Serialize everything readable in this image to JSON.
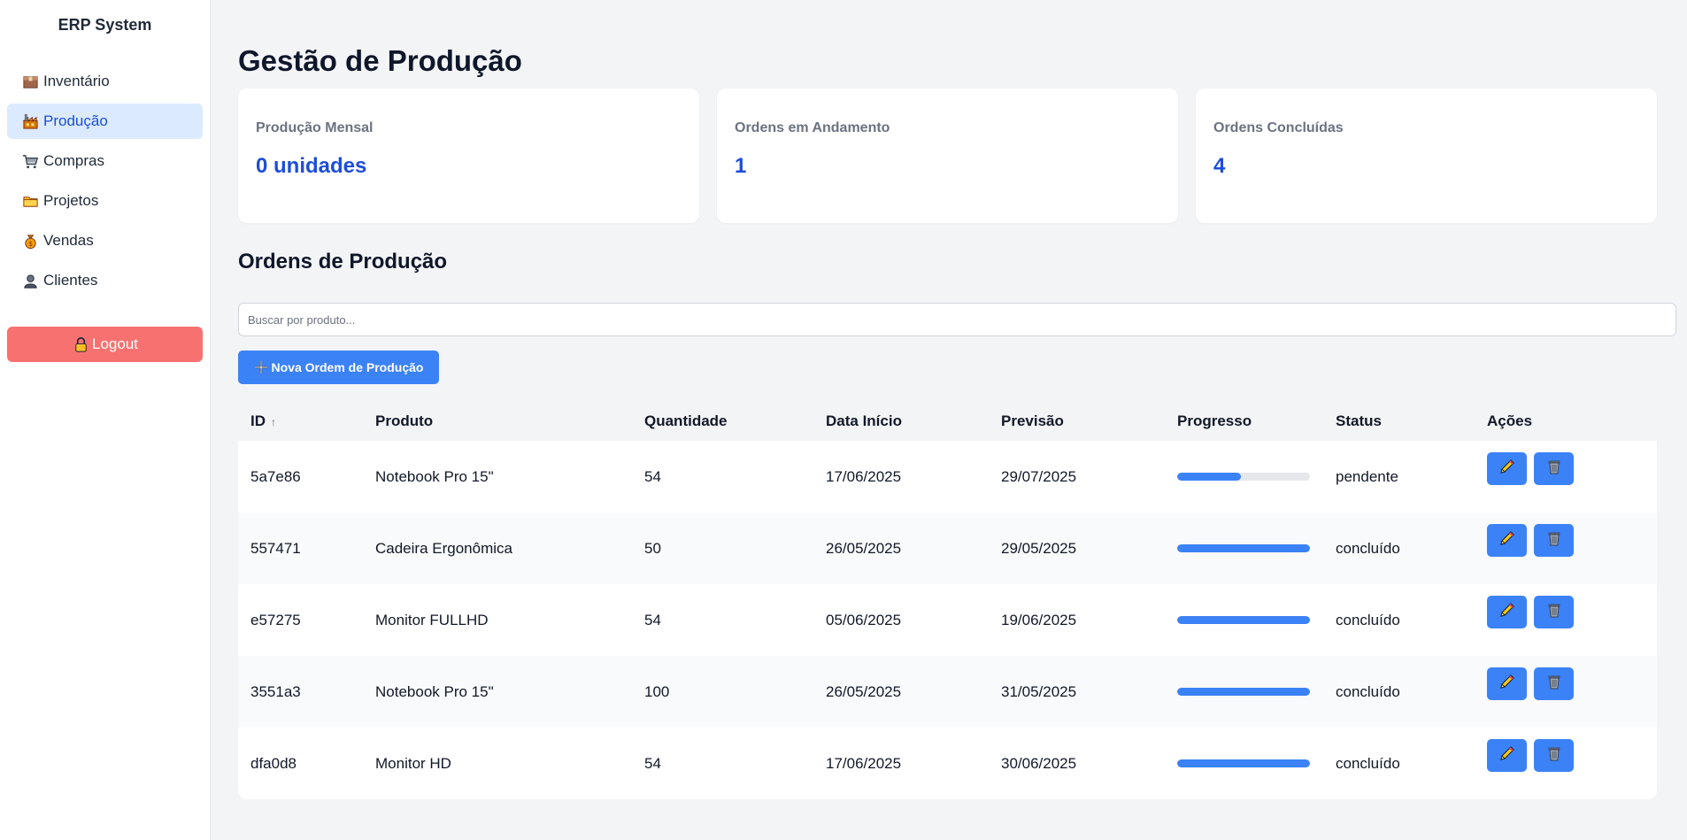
{
  "app": {
    "title": "ERP System"
  },
  "sidebar": {
    "items": [
      {
        "label": "Inventário",
        "icon": "package-icon",
        "active": false
      },
      {
        "label": "Produção",
        "icon": "factory-icon",
        "active": true
      },
      {
        "label": "Compras",
        "icon": "shopping-cart-icon",
        "active": false
      },
      {
        "label": "Projetos",
        "icon": "folder-icon",
        "active": false
      },
      {
        "label": "Vendas",
        "icon": "money-bag-icon",
        "active": false
      },
      {
        "label": "Clientes",
        "icon": "person-icon",
        "active": false
      }
    ],
    "logout_label": "Logout"
  },
  "main": {
    "page_title": "Gestão de Produção",
    "stats": [
      {
        "label": "Produção Mensal",
        "value": "0 unidades"
      },
      {
        "label": "Ordens em Andamento",
        "value": "1"
      },
      {
        "label": "Ordens Concluídas",
        "value": "4"
      }
    ],
    "section_title": "Ordens de Produção",
    "search": {
      "placeholder": "Buscar por produto..."
    },
    "new_button_label": "Nova Ordem de Produção",
    "table": {
      "headers": [
        "ID",
        "Produto",
        "Quantidade",
        "Data Início",
        "Previsão",
        "Progresso",
        "Status",
        "Ações"
      ],
      "sort_indicator": "↑",
      "rows": [
        {
          "id": "5a7e86",
          "produto": "Notebook Pro 15\"",
          "quantidade": "54",
          "data_inicio": "17/06/2025",
          "previsao": "29/07/2025",
          "progress": 0.48,
          "status": "pendente"
        },
        {
          "id": "557471",
          "produto": "Cadeira Ergonômica",
          "quantidade": "50",
          "data_inicio": "26/05/2025",
          "previsao": "29/05/2025",
          "progress": 1.0,
          "status": "concluído"
        },
        {
          "id": "e57275",
          "produto": "Monitor FULLHD",
          "quantidade": "54",
          "data_inicio": "05/06/2025",
          "previsao": "19/06/2025",
          "progress": 1.0,
          "status": "concluído"
        },
        {
          "id": "3551a3",
          "produto": "Notebook Pro 15\"",
          "quantidade": "100",
          "data_inicio": "26/05/2025",
          "previsao": "31/05/2025",
          "progress": 1.0,
          "status": "concluído"
        },
        {
          "id": "dfa0d8",
          "produto": "Monitor HD",
          "quantidade": "54",
          "data_inicio": "17/06/2025",
          "previsao": "30/06/2025",
          "progress": 1.0,
          "status": "concluído"
        }
      ]
    }
  },
  "colors": {
    "accent": "#3b82f6",
    "active_bg": "#dbeafe",
    "logout": "#f87171",
    "stat_value": "#1d4ed8"
  }
}
